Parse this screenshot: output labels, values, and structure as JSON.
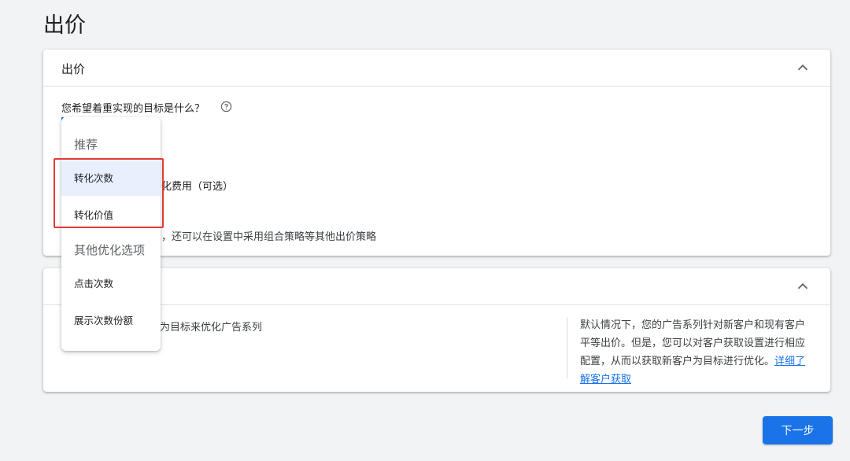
{
  "page": {
    "title": "出价"
  },
  "bidding_card": {
    "title": "出价",
    "question": "您希望着重实现的目标是什么？",
    "target_cost_label": "化费用（可选）",
    "hint": "，还可以在设置中采用组合策略等其他出价策略"
  },
  "customer_card": {
    "text": "为目标来优化广告系列",
    "info_text": "默认情况下，您的广告系列针对新客户和现有客户平等出价。但是，您可以对客户获取设置进行相应配置，从而以获取新客户为目标进行优化。",
    "info_link": "详细了解客户获取"
  },
  "dropdown": {
    "group_recommended": "推荐",
    "items_recommended": [
      "转化次数",
      "转化价值"
    ],
    "group_other": "其他优化选项",
    "items_other": [
      "点击次数",
      "展示次数份额"
    ]
  },
  "footer": {
    "next_label": "下一步"
  },
  "colors": {
    "accent": "#1a73e8",
    "highlight": "#e53935",
    "selected_bg": "#e8f0fe",
    "page_bg": "#f1f3f4"
  },
  "icons": {
    "collapse": "chevron-up-icon",
    "help": "help-circle-icon"
  }
}
